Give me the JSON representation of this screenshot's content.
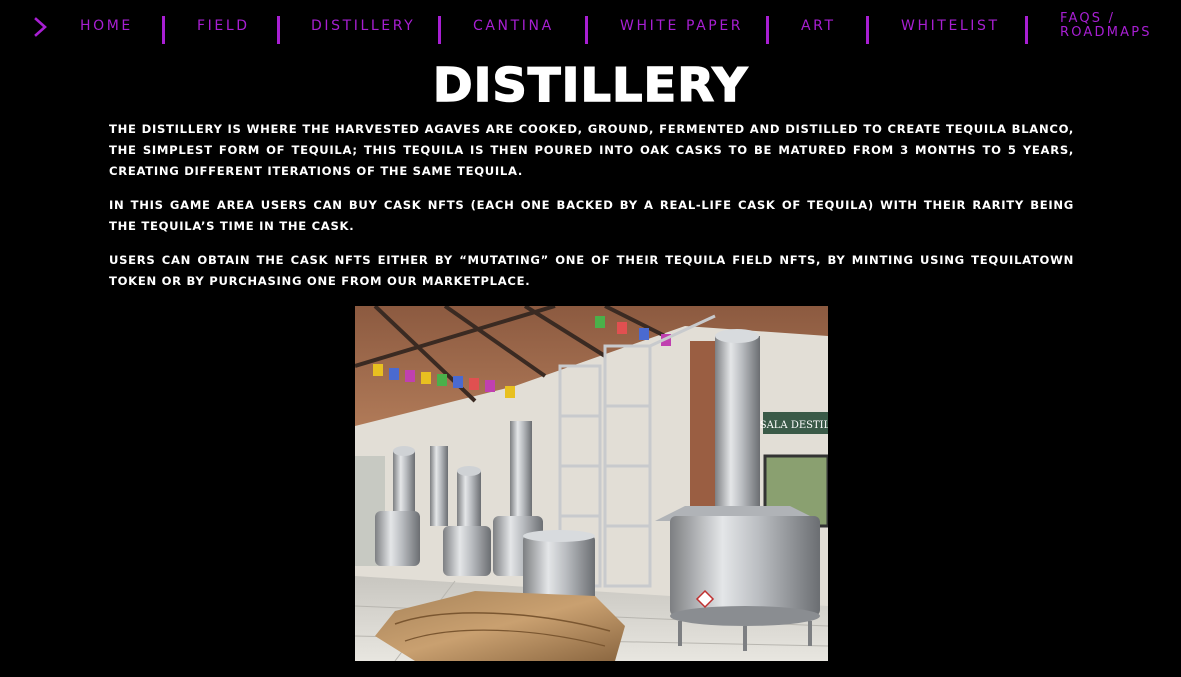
{
  "nav": {
    "items": [
      {
        "label": "HOME"
      },
      {
        "label": "FIELD"
      },
      {
        "label": "DISTILLERY"
      },
      {
        "label": "CANTINA"
      },
      {
        "label": "WHITE PAPER"
      },
      {
        "label": "ART"
      },
      {
        "label": "WHITELIST"
      },
      {
        "label_line1": "FAQS /",
        "label_line2": "ROADMAPS"
      }
    ],
    "chevron_icon": "chevron-right-icon",
    "accent_color": "#a81fd3"
  },
  "page": {
    "title": "DISTILLERY",
    "paragraphs": [
      "The distillery is where the harvested agaves are cooked, ground, fermented and distilled to create tequila blanco, the simplest form of tequila; this tequila is then poured into oak casks to be matured from 3 months to 5 years, creating different iterations of the same tequila.",
      "In this game area users can buy cask NFTs (each one backed by a real-life cask of tequila) with their rarity being the tequila’s time in the cask.",
      "Users can obtain the cask NFTs either by “mutating” one of their tequila field NFTs, by minting using Tequilatown token or by purchasing one from our marketplace."
    ]
  },
  "photo": {
    "sign_text": "SALA DESTIL"
  },
  "colors": {
    "background": "#000000",
    "text": "#ffffff",
    "accent": "#a81fd3"
  }
}
